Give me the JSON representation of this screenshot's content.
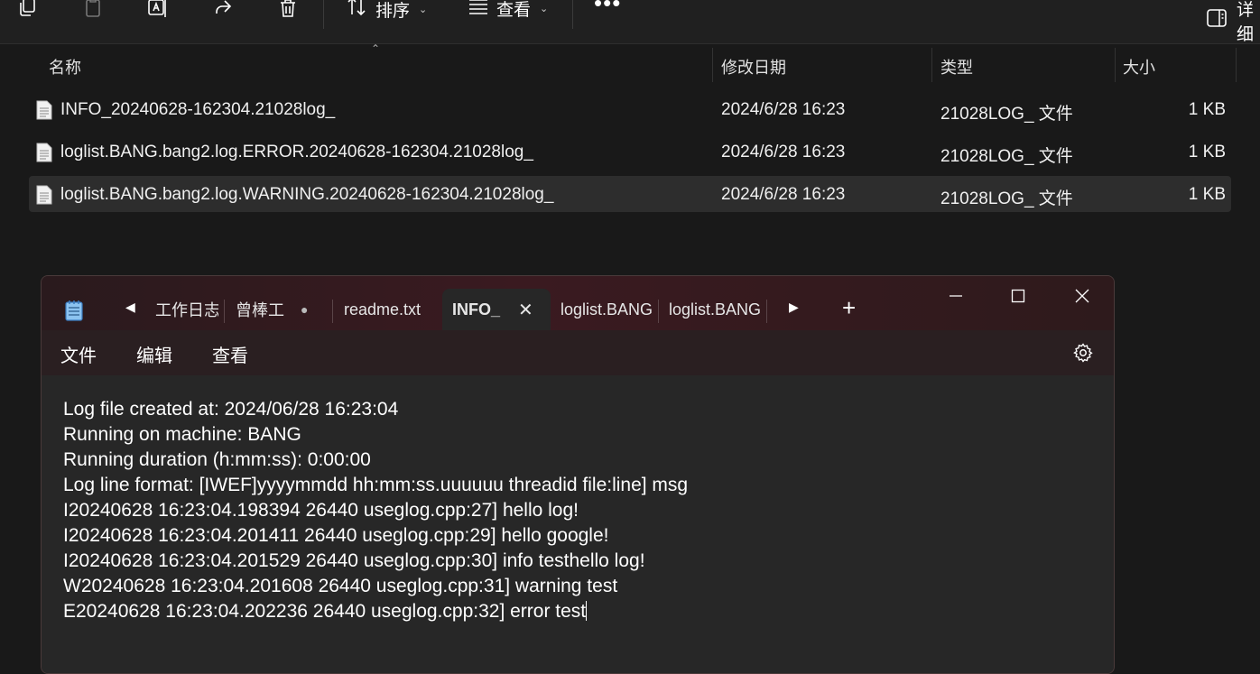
{
  "toolbar": {
    "sort_label": "排序",
    "view_label": "查看",
    "details_label": "详细"
  },
  "filelist": {
    "columns": {
      "name": "名称",
      "date": "修改日期",
      "type": "类型",
      "size": "大小"
    },
    "rows": [
      {
        "name": "INFO_20240628-162304.21028log_",
        "date": "2024/6/28 16:23",
        "type": "21028LOG_ 文件",
        "size": "1 KB",
        "selected": false
      },
      {
        "name": "loglist.BANG.bang2.log.ERROR.20240628-162304.21028log_",
        "date": "2024/6/28 16:23",
        "type": "21028LOG_ 文件",
        "size": "1 KB",
        "selected": false
      },
      {
        "name": "loglist.BANG.bang2.log.WARNING.20240628-162304.21028log_",
        "date": "2024/6/28 16:23",
        "type": "21028LOG_ 文件",
        "size": "1 KB",
        "selected": true
      }
    ]
  },
  "notepad": {
    "tabs": [
      {
        "label": "工作日志"
      },
      {
        "label": "曾棒工"
      },
      {
        "label": "readme.txt"
      },
      {
        "label": "INFO_"
      },
      {
        "label": "loglist.BANG"
      },
      {
        "label": "loglist.BANG"
      }
    ],
    "menu": {
      "file": "文件",
      "edit": "编辑",
      "view": "查看"
    },
    "lines": [
      "Log file created at: 2024/06/28 16:23:04",
      "Running on machine: BANG",
      "Running duration (h:mm:ss): 0:00:00",
      "Log line format: [IWEF]yyyymmdd hh:mm:ss.uuuuuu threadid file:line] msg",
      "I20240628 16:23:04.198394 26440 useglog.cpp:27] hello log!",
      "I20240628 16:23:04.201411 26440 useglog.cpp:29] hello google!",
      "I20240628 16:23:04.201529 26440 useglog.cpp:30] info testhello log!",
      "W20240628 16:23:04.201608 26440 useglog.cpp:31] warning test",
      "E20240628 16:23:04.202236 26440 useglog.cpp:32] error test"
    ]
  }
}
